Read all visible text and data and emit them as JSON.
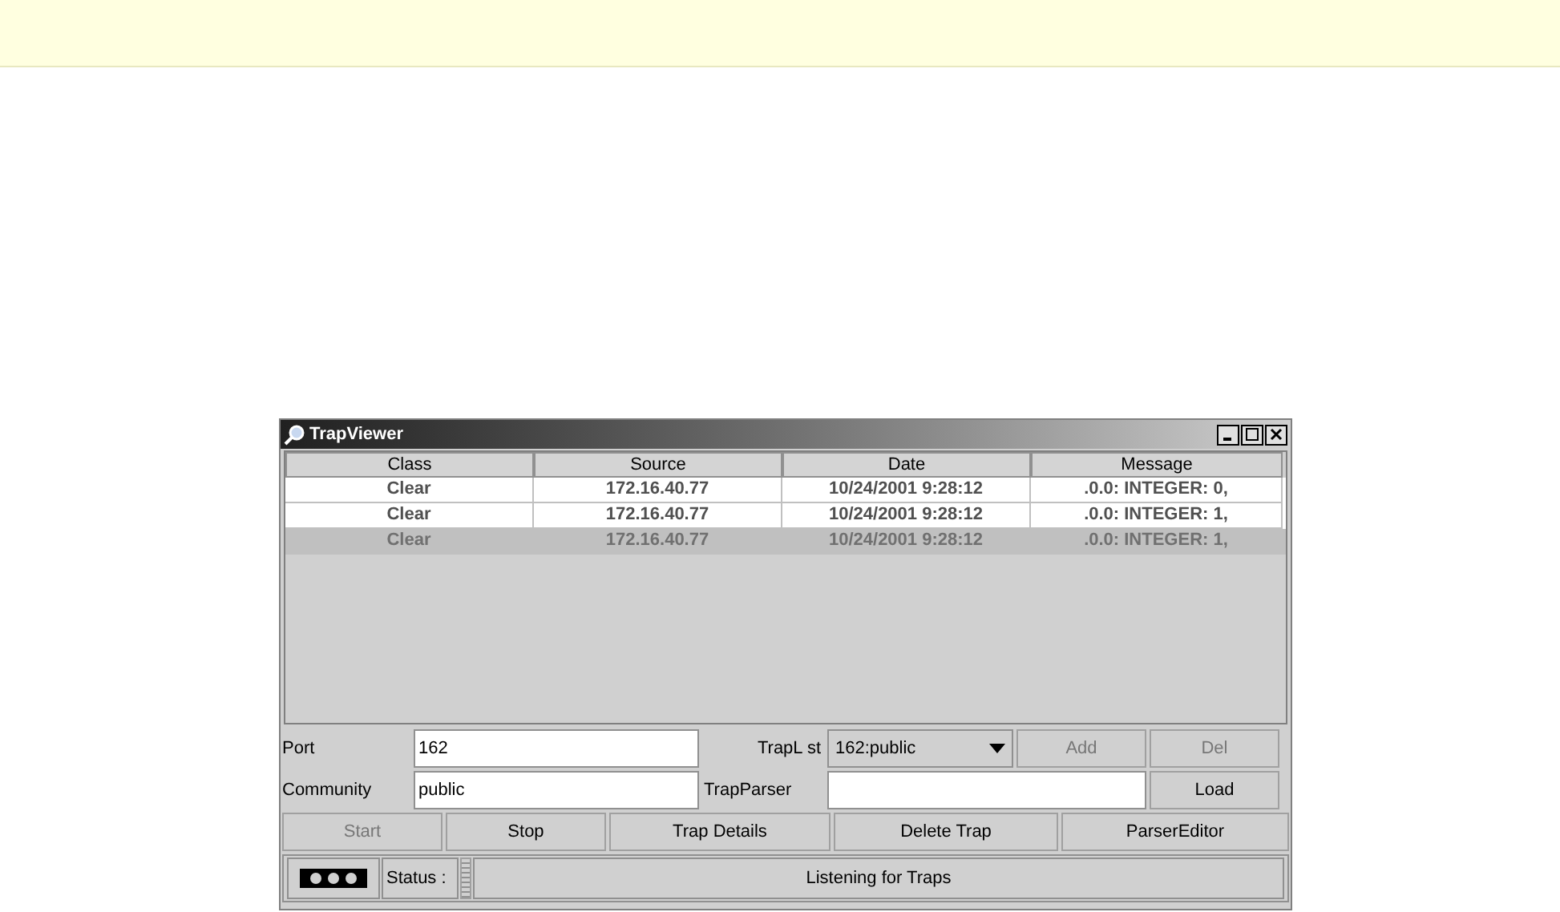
{
  "window": {
    "title": "TrapViewer"
  },
  "table": {
    "columns": [
      "Class",
      "Source",
      "Date",
      "Message"
    ],
    "rows": [
      {
        "cells": [
          "Clear",
          "172.16.40.77",
          "10/24/2001 9:28:12",
          ".0.0: INTEGER: 0,"
        ],
        "selected": false
      },
      {
        "cells": [
          "Clear",
          "172.16.40.77",
          "10/24/2001 9:28:12",
          ".0.0: INTEGER: 1,"
        ],
        "selected": false
      },
      {
        "cells": [
          "Clear",
          "172.16.40.77",
          "10/24/2001 9:28:12",
          ".0.0: INTEGER: 1,"
        ],
        "selected": true
      }
    ]
  },
  "form": {
    "port_label": "Port",
    "port_value": "162",
    "traplist_label": "TrapL st",
    "traplist_value": "162:public",
    "add_button": {
      "label": "Add",
      "disabled": true
    },
    "del_button": {
      "label": "Del",
      "disabled": true
    },
    "community_label": "Community",
    "community_value": "public",
    "trapparser_label": "TrapParser",
    "load_button": {
      "label": "Load",
      "disabled": false
    }
  },
  "buttons": [
    {
      "label": "Start",
      "disabled": true
    },
    {
      "label": "Stop",
      "disabled": false
    },
    {
      "label": "Trap Details",
      "disabled": false
    },
    {
      "label": "Delete Trap",
      "disabled": false
    },
    {
      "label": "ParserEditor",
      "disabled": false
    }
  ],
  "status_bar": {
    "label": "Status :",
    "message": "Listening for Traps"
  }
}
